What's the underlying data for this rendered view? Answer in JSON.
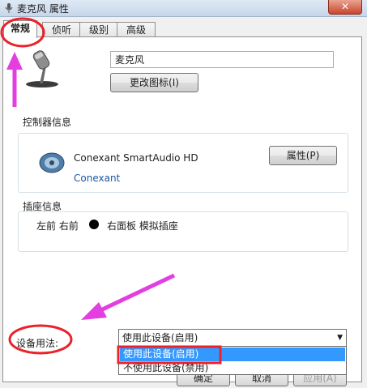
{
  "window": {
    "title": "麦克风 属性",
    "close_label": "✕"
  },
  "tabs": [
    {
      "label": "常规",
      "active": true
    },
    {
      "label": "侦听",
      "active": false
    },
    {
      "label": "级别",
      "active": false
    },
    {
      "label": "高级",
      "active": false
    }
  ],
  "device": {
    "name": "麦克风",
    "change_icon_label": "更改图标(I)"
  },
  "controller": {
    "section_title": "控制器信息",
    "name": "Conexant SmartAudio HD",
    "vendor": "Conexant",
    "properties_label": "属性(P)"
  },
  "jack": {
    "section_title": "插座信息",
    "left_text": "左前 右前",
    "right_text": "右面板 模拟插座"
  },
  "usage": {
    "label": "设备用法:",
    "selected": "使用此设备(启用)",
    "options": [
      "使用此设备(启用)",
      "不使用此设备(禁用)"
    ]
  },
  "footer": {
    "ok_label": "确定",
    "cancel_label": "取消",
    "apply_label": "应用(A)"
  },
  "colors": {
    "annotation_red": "#e8232b",
    "annotation_magenta": "#e33ee0",
    "selection_blue": "#3399ff"
  }
}
